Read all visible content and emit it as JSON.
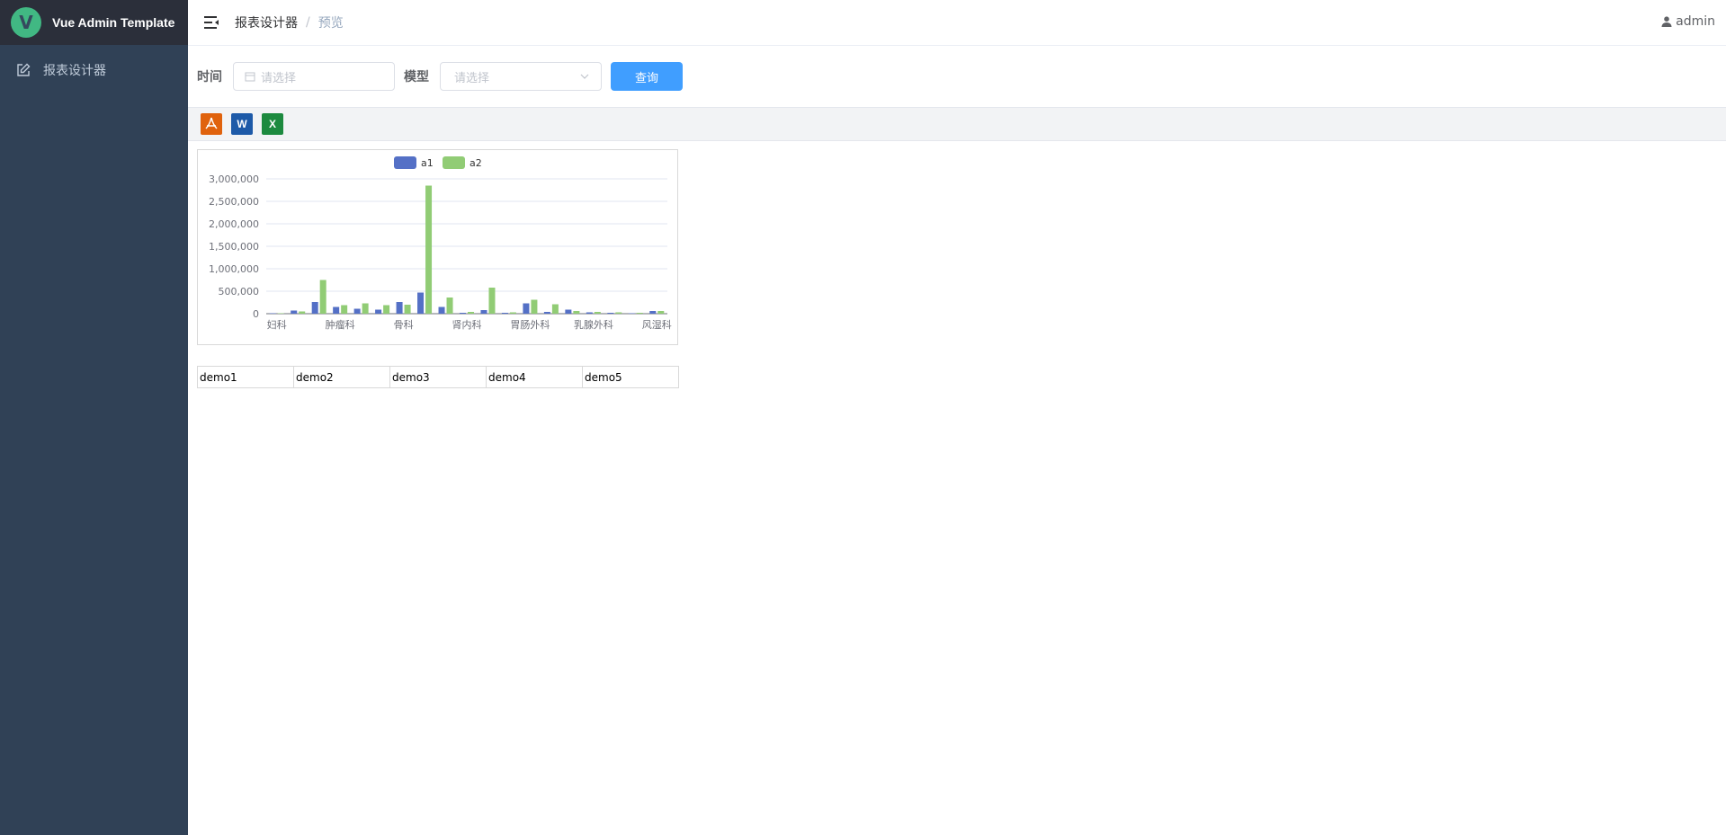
{
  "app": {
    "title": "Vue Admin Template",
    "logo_letter": "V"
  },
  "sidebar": {
    "items": [
      {
        "label": "报表设计器",
        "icon": "edit-icon"
      }
    ]
  },
  "header": {
    "breadcrumb": [
      "报表设计器",
      "预览"
    ],
    "user": "admin"
  },
  "filter": {
    "time_label": "时间",
    "time_placeholder": "请选择",
    "model_label": "模型",
    "model_placeholder": "请选择",
    "query_label": "查询"
  },
  "export": {
    "pdf_label": "",
    "word_label": "W",
    "excel_label": "X"
  },
  "colors": {
    "accent": "#409eff",
    "sidebar": "#304156",
    "series_a1": "#5470c6",
    "series_a2": "#91cc75"
  },
  "chart_data": {
    "type": "bar",
    "categories": [
      "妇科",
      "",
      "",
      "肿瘤科",
      "",
      "",
      "骨科",
      "",
      "",
      "肾内科",
      "",
      "",
      "胃肠外科",
      "",
      "",
      "乳腺外科",
      "",
      "",
      "风湿科"
    ],
    "series": [
      {
        "name": "a1",
        "values": [
          10000,
          70000,
          260000,
          150000,
          110000,
          90000,
          260000,
          470000,
          150000,
          20000,
          80000,
          20000,
          230000,
          40000,
          90000,
          30000,
          20000,
          10000,
          60000
        ]
      },
      {
        "name": "a2",
        "values": [
          10000,
          50000,
          750000,
          190000,
          230000,
          190000,
          200000,
          2850000,
          360000,
          40000,
          580000,
          30000,
          310000,
          210000,
          60000,
          40000,
          30000,
          20000,
          60000
        ]
      }
    ],
    "ylim": [
      0,
      3000000
    ],
    "yticks": [
      "3,000,000",
      "2,500,000",
      "2,000,000",
      "1,500,000",
      "1,000,000",
      "500,000",
      "0"
    ],
    "legend_position": "top-center",
    "grid": true
  },
  "table": {
    "cells": [
      "demo1",
      "demo2",
      "demo3",
      "demo4",
      "demo5"
    ]
  }
}
